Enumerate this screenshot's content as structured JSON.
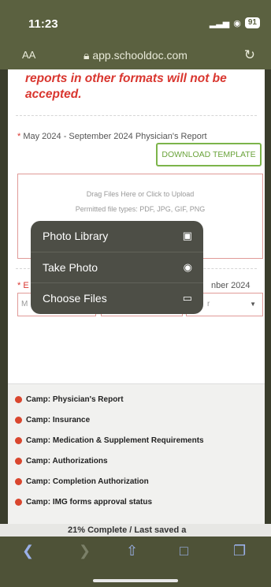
{
  "status_bar": {
    "time": "11:23",
    "battery": "91",
    "signal_icon": "signal-icon",
    "wifi_icon": "wifi-icon"
  },
  "address_bar": {
    "aa_label": "AA",
    "lock_icon": "lock-icon",
    "url": "app.schooldoc.com",
    "reload_icon": "reload-icon"
  },
  "page": {
    "warning_line1": "reports in other formats will not be",
    "warning_line2": "accepted.",
    "report_label": "May 2024 - September 2024 Physician's Report",
    "download_button": "DOWNLOAD TEMPLATE",
    "upload_line1": "Drag Files Here or Click to Upload",
    "upload_line2": "Permitted file types: PDF, JPG, GIF, PNG",
    "row2_label_left": "* E",
    "row2_label_right": "nber 2024",
    "select_left": "M",
    "select_right": "r"
  },
  "popup_menu": {
    "items": [
      {
        "label": "Photo Library",
        "icon": "photo-library-icon"
      },
      {
        "label": "Take Photo",
        "icon": "camera-icon"
      },
      {
        "label": "Choose Files",
        "icon": "folder-icon"
      }
    ]
  },
  "checklist": {
    "status_color": "#d9462e",
    "items": [
      "Camp: Physician's Report",
      "Camp: Insurance",
      "Camp: Medication & Supplement Requirements",
      "Camp: Authorizations",
      "Camp: Completion Authorization",
      "Camp: IMG forms approval status"
    ]
  },
  "progress": {
    "text": "21% Complete / Last saved a"
  },
  "toolbar": {
    "back_icon": "back-icon",
    "forward_icon": "forward-icon",
    "share_icon": "share-icon",
    "bookmarks_icon": "bookmarks-icon",
    "tabs_icon": "tabs-icon"
  }
}
